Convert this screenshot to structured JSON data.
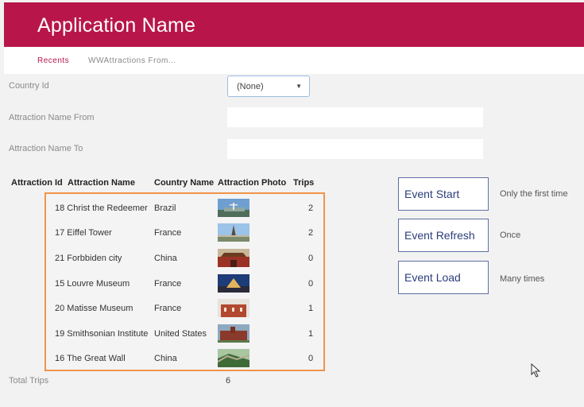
{
  "header": {
    "title": "Application Name"
  },
  "breadcrumb": {
    "recents": "Recents",
    "current": "WWAttractions From..."
  },
  "filters": {
    "country_id_label": "Country Id",
    "country_id_value": "(None)",
    "name_from_label": "Attraction Name From",
    "name_from_value": "",
    "name_to_label": "Attraction Name To",
    "name_to_value": ""
  },
  "grid": {
    "headers": {
      "id": "Attraction Id",
      "name": "Attraction Name",
      "country": "Country Name",
      "photo": "Attraction Photo",
      "trips": "Trips"
    },
    "rows": [
      {
        "id_name": "18 Christ the Redeemer",
        "country": "Brazil",
        "trips": "2",
        "photo": "christ-redeemer-photo"
      },
      {
        "id_name": "17 Eiffel Tower",
        "country": "France",
        "trips": "2",
        "photo": "eiffel-tower-photo"
      },
      {
        "id_name": "21 Forbbiden city",
        "country": "China",
        "trips": "0",
        "photo": "forbidden-city-photo"
      },
      {
        "id_name": "15 Louvre Museum",
        "country": "France",
        "trips": "0",
        "photo": "louvre-museum-photo"
      },
      {
        "id_name": "20 Matisse Museum",
        "country": "France",
        "trips": "1",
        "photo": "matisse-museum-photo"
      },
      {
        "id_name": "19 Smithsonian Institute",
        "country": "United States",
        "trips": "1",
        "photo": "smithsonian-photo"
      },
      {
        "id_name": "16 The Great Wall",
        "country": "China",
        "trips": "0",
        "photo": "great-wall-photo"
      }
    ]
  },
  "events": [
    {
      "label": "Event Start",
      "note": "Only the first time"
    },
    {
      "label": "Event Refresh",
      "note": "Once"
    },
    {
      "label": "Event Load",
      "note": "Many times"
    }
  ],
  "totals": {
    "label": "Total Trips",
    "value": "6"
  },
  "colors": {
    "header_bg": "#b8164b",
    "grid_border": "#f0944a",
    "event_border": "#5f6fa3"
  }
}
